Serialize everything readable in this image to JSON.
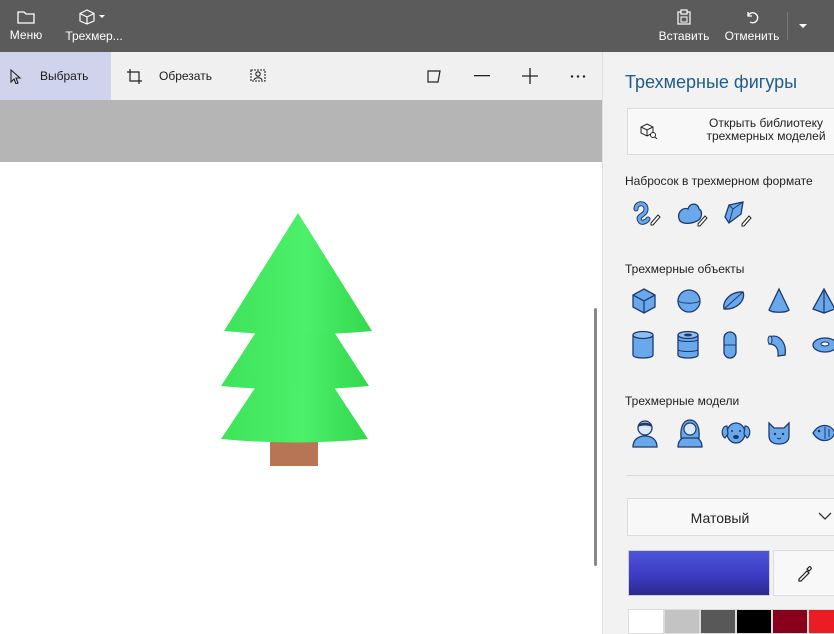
{
  "topbar": {
    "menu_label": "Меню",
    "shapes3d_label": "Трехмер...",
    "paste_label": "Вставить",
    "undo_label": "Отменить"
  },
  "subbar": {
    "select_label": "Выбрать",
    "crop_label": "Обрезать"
  },
  "panel": {
    "title": "Трехмерные фигуры",
    "library_button": "Открыть библиотеку трехмерных моделей",
    "sketch_section": "Набросок в трехмерном формате",
    "objects_section": "Трехмерные объекты",
    "models_section": "Трехмерные модели",
    "material_value": "Матовый",
    "sketch_tools": [
      "tube-doodle-icon",
      "soft-edge-doodle-icon",
      "sharp-edge-doodle-icon"
    ],
    "objects_row1": [
      "cube-icon",
      "sphere-icon",
      "hemisphere-icon",
      "cone-icon",
      "pyramid-icon"
    ],
    "objects_row2": [
      "cylinder-icon",
      "tube-icon",
      "capsule-icon",
      "curved-tube-icon",
      "torus-icon"
    ],
    "models": [
      "man-icon",
      "woman-icon",
      "dog-icon",
      "cat-icon",
      "fish-icon"
    ],
    "current_color": "#3e42c8",
    "palette": [
      "#ffffff",
      "#c3c3c3",
      "#585858",
      "#000000",
      "#88001b",
      "#ec1c24"
    ]
  },
  "colors": {
    "tree_green": "#3ee35a",
    "trunk": "#b87556",
    "accent_title": "#1f5d8a",
    "select_highlight": "#d0d3ec"
  }
}
